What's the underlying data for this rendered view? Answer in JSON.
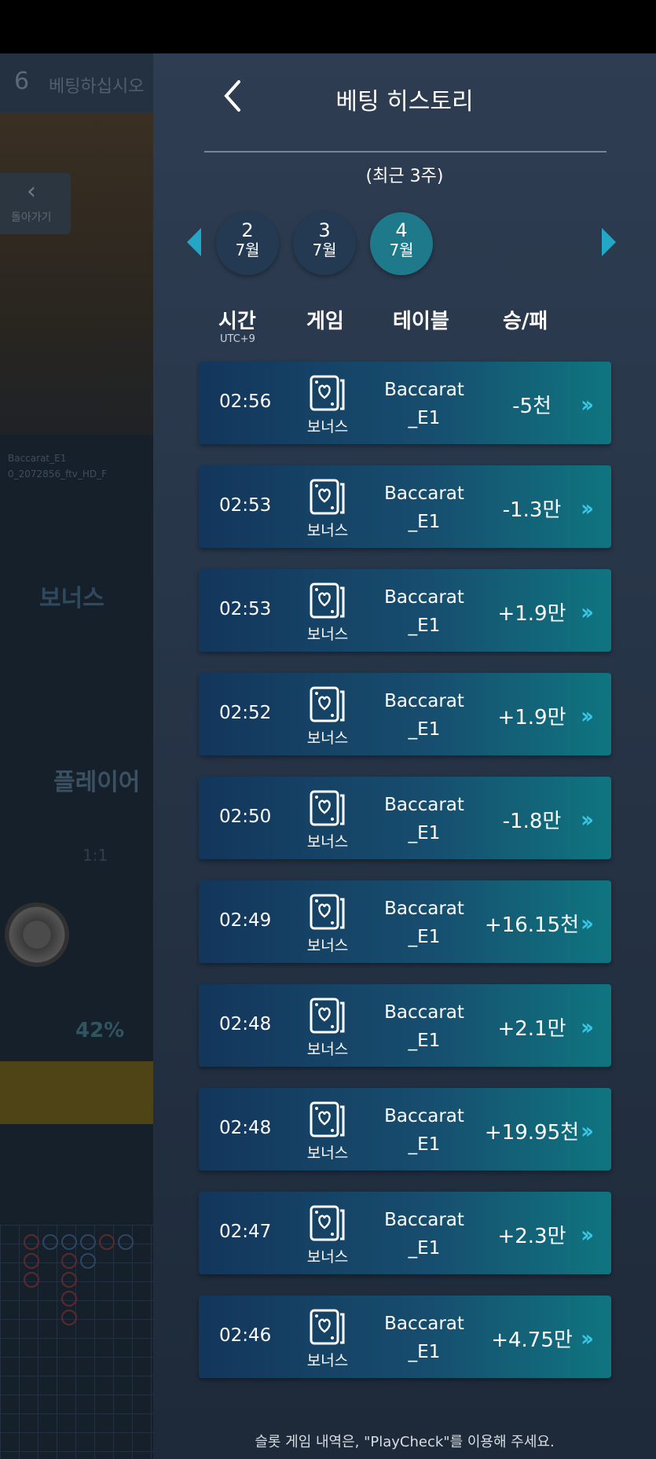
{
  "background": {
    "round": "6",
    "message": "베팅하십시오",
    "back_label": "돌아가기",
    "table_label_1": "Baccarat_E1",
    "table_label_2": "0_2072856_ftv_HD_F",
    "bonus_label": "보너스",
    "player_label": "플레이어",
    "ratio": "1:1",
    "percent": "42%"
  },
  "header": {
    "title": "베팅 히스토리",
    "subtitle": "(최근 3주)"
  },
  "dates": [
    {
      "day": "2",
      "month": "7월"
    },
    {
      "day": "3",
      "month": "7월"
    },
    {
      "day": "4",
      "month": "7월"
    }
  ],
  "columns": {
    "time": "시간",
    "time_sub": "UTC+9",
    "game": "게임",
    "table": "테이블",
    "result": "승/패"
  },
  "rows": [
    {
      "time": "02:56",
      "game": "보너스",
      "table_1": "Baccarat",
      "table_2": "_E1",
      "result": "-5천"
    },
    {
      "time": "02:53",
      "game": "보너스",
      "table_1": "Baccarat",
      "table_2": "_E1",
      "result": "-1.3만"
    },
    {
      "time": "02:53",
      "game": "보너스",
      "table_1": "Baccarat",
      "table_2": "_E1",
      "result": "+1.9만"
    },
    {
      "time": "02:52",
      "game": "보너스",
      "table_1": "Baccarat",
      "table_2": "_E1",
      "result": "+1.9만"
    },
    {
      "time": "02:50",
      "game": "보너스",
      "table_1": "Baccarat",
      "table_2": "_E1",
      "result": "-1.8만"
    },
    {
      "time": "02:49",
      "game": "보너스",
      "table_1": "Baccarat",
      "table_2": "_E1",
      "result": "+16.15천"
    },
    {
      "time": "02:48",
      "game": "보너스",
      "table_1": "Baccarat",
      "table_2": "_E1",
      "result": "+2.1만"
    },
    {
      "time": "02:48",
      "game": "보너스",
      "table_1": "Baccarat",
      "table_2": "_E1",
      "result": "+19.95천"
    },
    {
      "time": "02:47",
      "game": "보너스",
      "table_1": "Baccarat",
      "table_2": "_E1",
      "result": "+2.3만"
    },
    {
      "time": "02:46",
      "game": "보너스",
      "table_1": "Baccarat",
      "table_2": "_E1",
      "result": "+4.75만"
    }
  ],
  "footer": "슬롯 게임 내역은, \"PlayCheck\"를 이용해 주세요."
}
